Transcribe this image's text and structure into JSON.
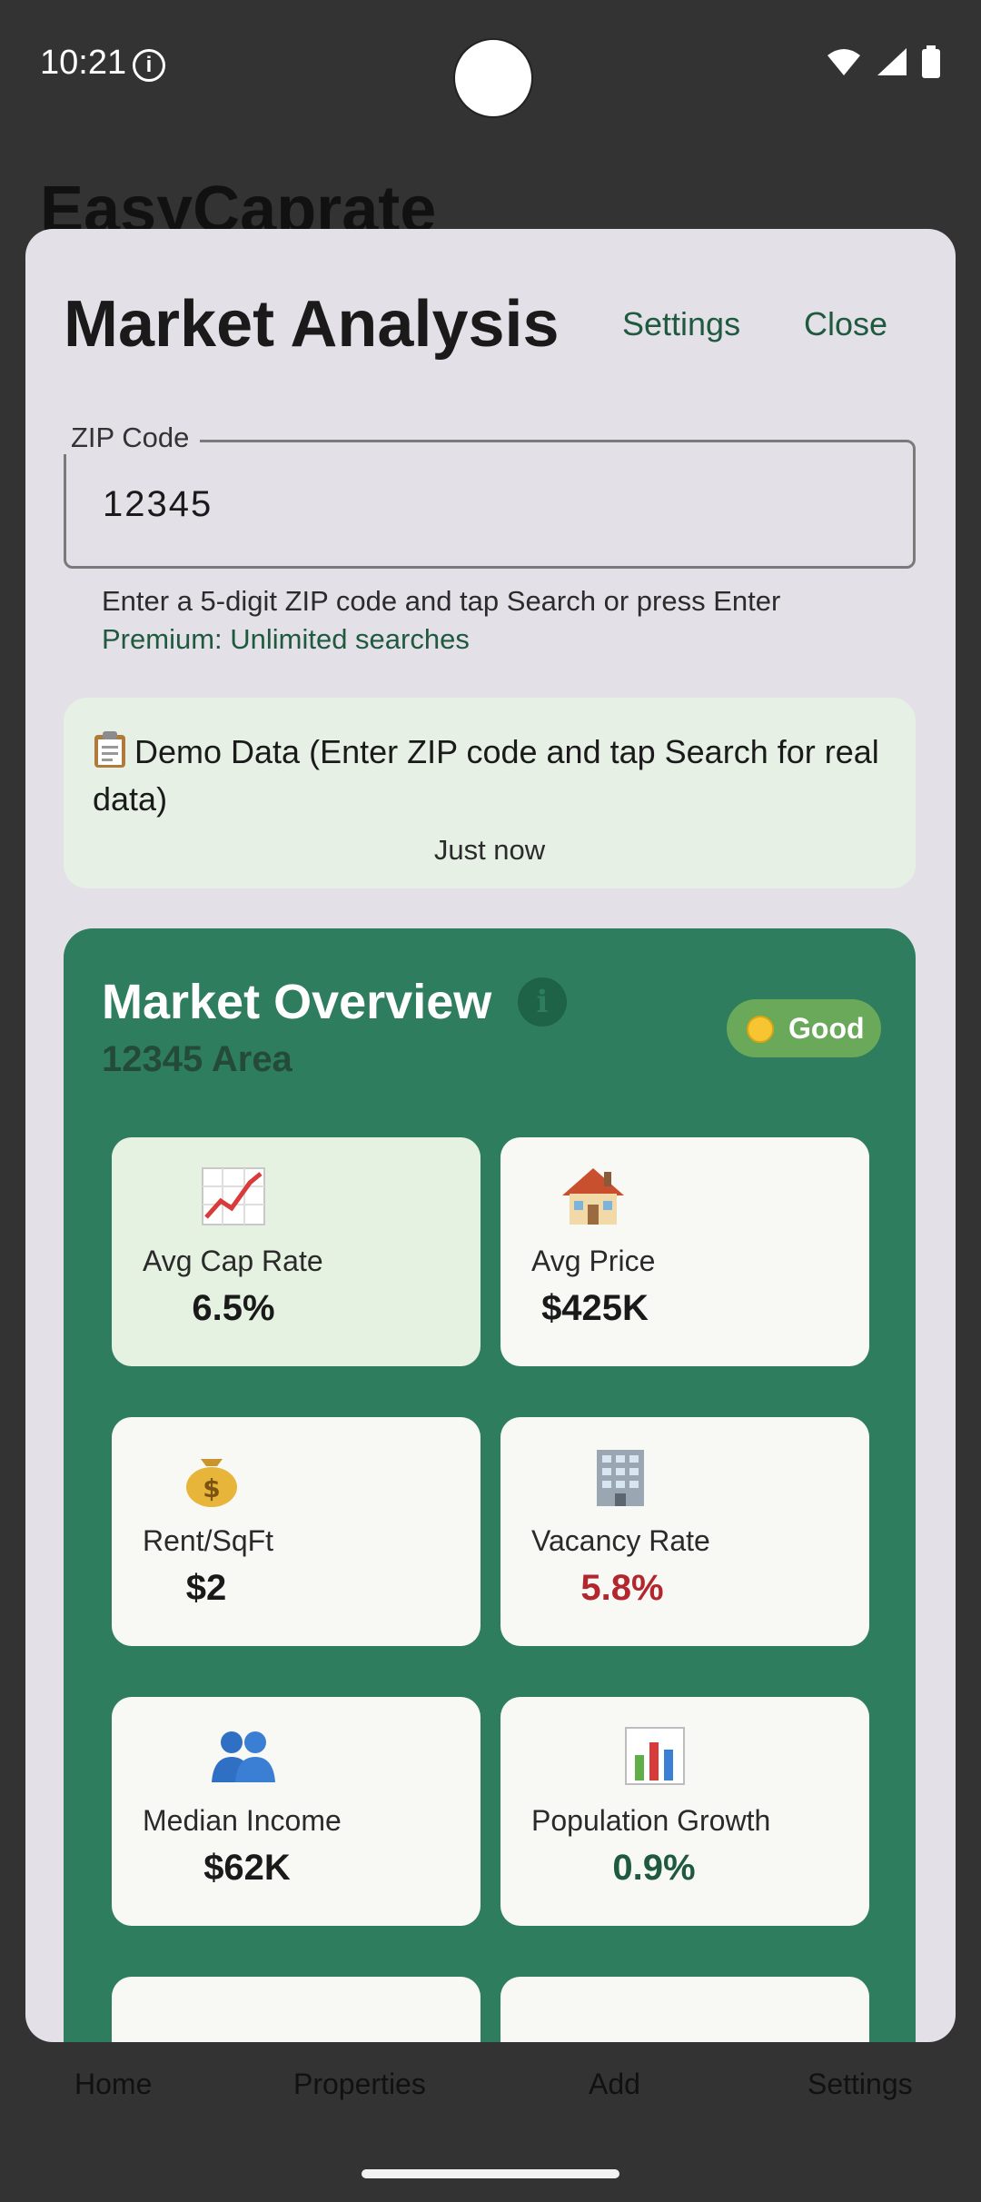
{
  "status_bar": {
    "time": "10:21",
    "info_icon": "info-circle-icon",
    "wifi_icon": "wifi-icon",
    "signal_icon": "signal-icon",
    "battery_icon": "battery-icon"
  },
  "background": {
    "app_title": "EasyCaprate"
  },
  "bottom_nav": {
    "items": [
      "Home",
      "Properties",
      "Add",
      "Settings"
    ]
  },
  "sheet": {
    "title": "Market Analysis",
    "settings_label": "Settings",
    "close_label": "Close"
  },
  "zip": {
    "label": "ZIP Code",
    "value": "12345",
    "helper": "Enter a 5-digit ZIP code and tap Search or press Enter",
    "premium": "Premium: Unlimited searches"
  },
  "demo": {
    "icon": "clipboard-icon",
    "title": "Demo Data (Enter ZIP code and tap Search for real data)",
    "time": "Just now"
  },
  "overview": {
    "title": "Market Overview",
    "area": "12345 Area",
    "badge": "Good",
    "badge_color": "#f7c531",
    "card_color": "#2e7d5f",
    "metrics": [
      {
        "icon": "chart-increasing-icon",
        "label": "Avg Cap Rate",
        "value": "6.5%",
        "value_color": "#1a1a1a"
      },
      {
        "icon": "house-icon",
        "label": "Avg Price",
        "value": "$425K",
        "value_color": "#1a1a1a"
      },
      {
        "icon": "money-bag-icon",
        "label": "Rent/SqFt",
        "value": "$2",
        "value_color": "#1a1a1a"
      },
      {
        "icon": "office-building-icon",
        "label": "Vacancy Rate",
        "value": "5.8%",
        "value_color": "#b3262d"
      },
      {
        "icon": "people-icon",
        "label": "Median Income",
        "value": "$62K",
        "value_color": "#1a1a1a"
      },
      {
        "icon": "bar-chart-icon",
        "label": "Population Growth",
        "value": "0.9%",
        "value_color": "#1f5a3f"
      }
    ]
  }
}
